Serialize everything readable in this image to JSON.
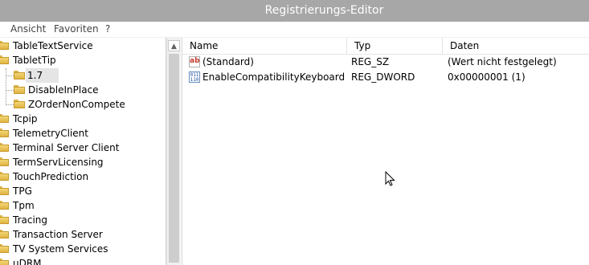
{
  "window": {
    "title": "Registrierungs-Editor"
  },
  "menu": {
    "items": [
      "Ansicht",
      "Favoriten",
      "?"
    ]
  },
  "tree": {
    "items": [
      {
        "label": "TableTextService"
      },
      {
        "label": "TabletTip"
      },
      {
        "label": "1.7",
        "selected": true
      },
      {
        "label": "DisableInPlace"
      },
      {
        "label": "ZOrderNonCompete"
      },
      {
        "label": "Tcpip"
      },
      {
        "label": "TelemetryClient"
      },
      {
        "label": "Terminal Server Client"
      },
      {
        "label": "TermServLicensing"
      },
      {
        "label": "TouchPrediction"
      },
      {
        "label": "TPG"
      },
      {
        "label": "Tpm"
      },
      {
        "label": "Tracing"
      },
      {
        "label": "Transaction Server"
      },
      {
        "label": "TV System Services"
      },
      {
        "label": "uDRM"
      }
    ]
  },
  "values": {
    "columns": [
      "Name",
      "Typ",
      "Daten"
    ],
    "rows": [
      {
        "icon": "string-value-icon",
        "name": "(Standard)",
        "type": "REG_SZ",
        "data": "(Wert nicht festgelegt)"
      },
      {
        "icon": "binary-value-icon",
        "name": "EnableCompatibilityKeyboard",
        "type": "REG_DWORD",
        "data": "0x00000001 (1)"
      }
    ]
  },
  "icons": {
    "string": "ab",
    "binary": "011\n110"
  }
}
